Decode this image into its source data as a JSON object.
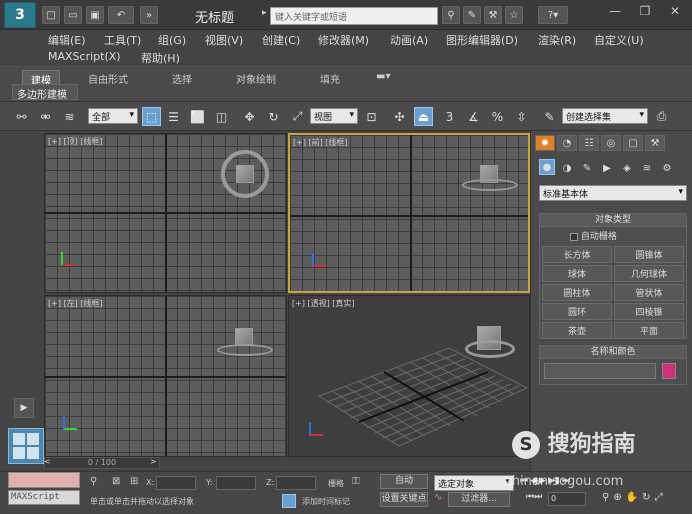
{
  "titlebar": {
    "title": "无标题",
    "search_placeholder": "键入关键字或短语",
    "logo": "3",
    "undo_label": "↶"
  },
  "menu": {
    "row1": [
      "编辑(E)",
      "工具(T)",
      "组(G)",
      "视图(V)",
      "创建(C)",
      "修改器(M)",
      "动画(A)",
      "图形编辑器(D)",
      "渲染(R)",
      "自定义(U)"
    ],
    "row2": [
      "MAXScript(X)",
      "帮助(H)"
    ]
  },
  "ribbon": {
    "tabs": [
      "建模",
      "自由形式",
      "选择",
      "对象绘制",
      "填充"
    ],
    "active_tab": "建模",
    "panel_label": "多边形建模"
  },
  "toolbar": {
    "selection_filter": "全部",
    "reference_coord": "视图",
    "named_selection": "创建选择集",
    "snap_label": "3"
  },
  "viewports": {
    "top": "[+] [顶] [线框]",
    "front": "[+] [前] [线框]",
    "left": "[+] [左] [线框]",
    "perspective": "[+] [透视] [真实]"
  },
  "command_panel": {
    "category": "标准基本体",
    "rollout_object_type": "对象类型",
    "autogrid_label": "自动栅格",
    "objects": [
      "长方体",
      "圆锥体",
      "球体",
      "几何球体",
      "圆柱体",
      "管状体",
      "圆环",
      "四棱锥",
      "茶壶",
      "平面"
    ],
    "rollout_name_color": "名称和颜色",
    "object_color": "#d0307a"
  },
  "timeline": {
    "frame_display": "0 / 100"
  },
  "status": {
    "x_label": "X:",
    "y_label": "Y:",
    "z_label": "Z:",
    "grid_label": "栅格",
    "auto_label": "自动",
    "set_key_label": "设置关键点",
    "selected_object": "选定对象",
    "filter_label": "过滤器...",
    "prompt": "单击或单击并拖动以选择对象",
    "add_time_tag": "添加时间标记",
    "maxscript_label": "MAXScript",
    "frame_value": "0"
  },
  "watermark": {
    "main": "搜狗指南",
    "sub": "zhinan.sogou.com"
  }
}
